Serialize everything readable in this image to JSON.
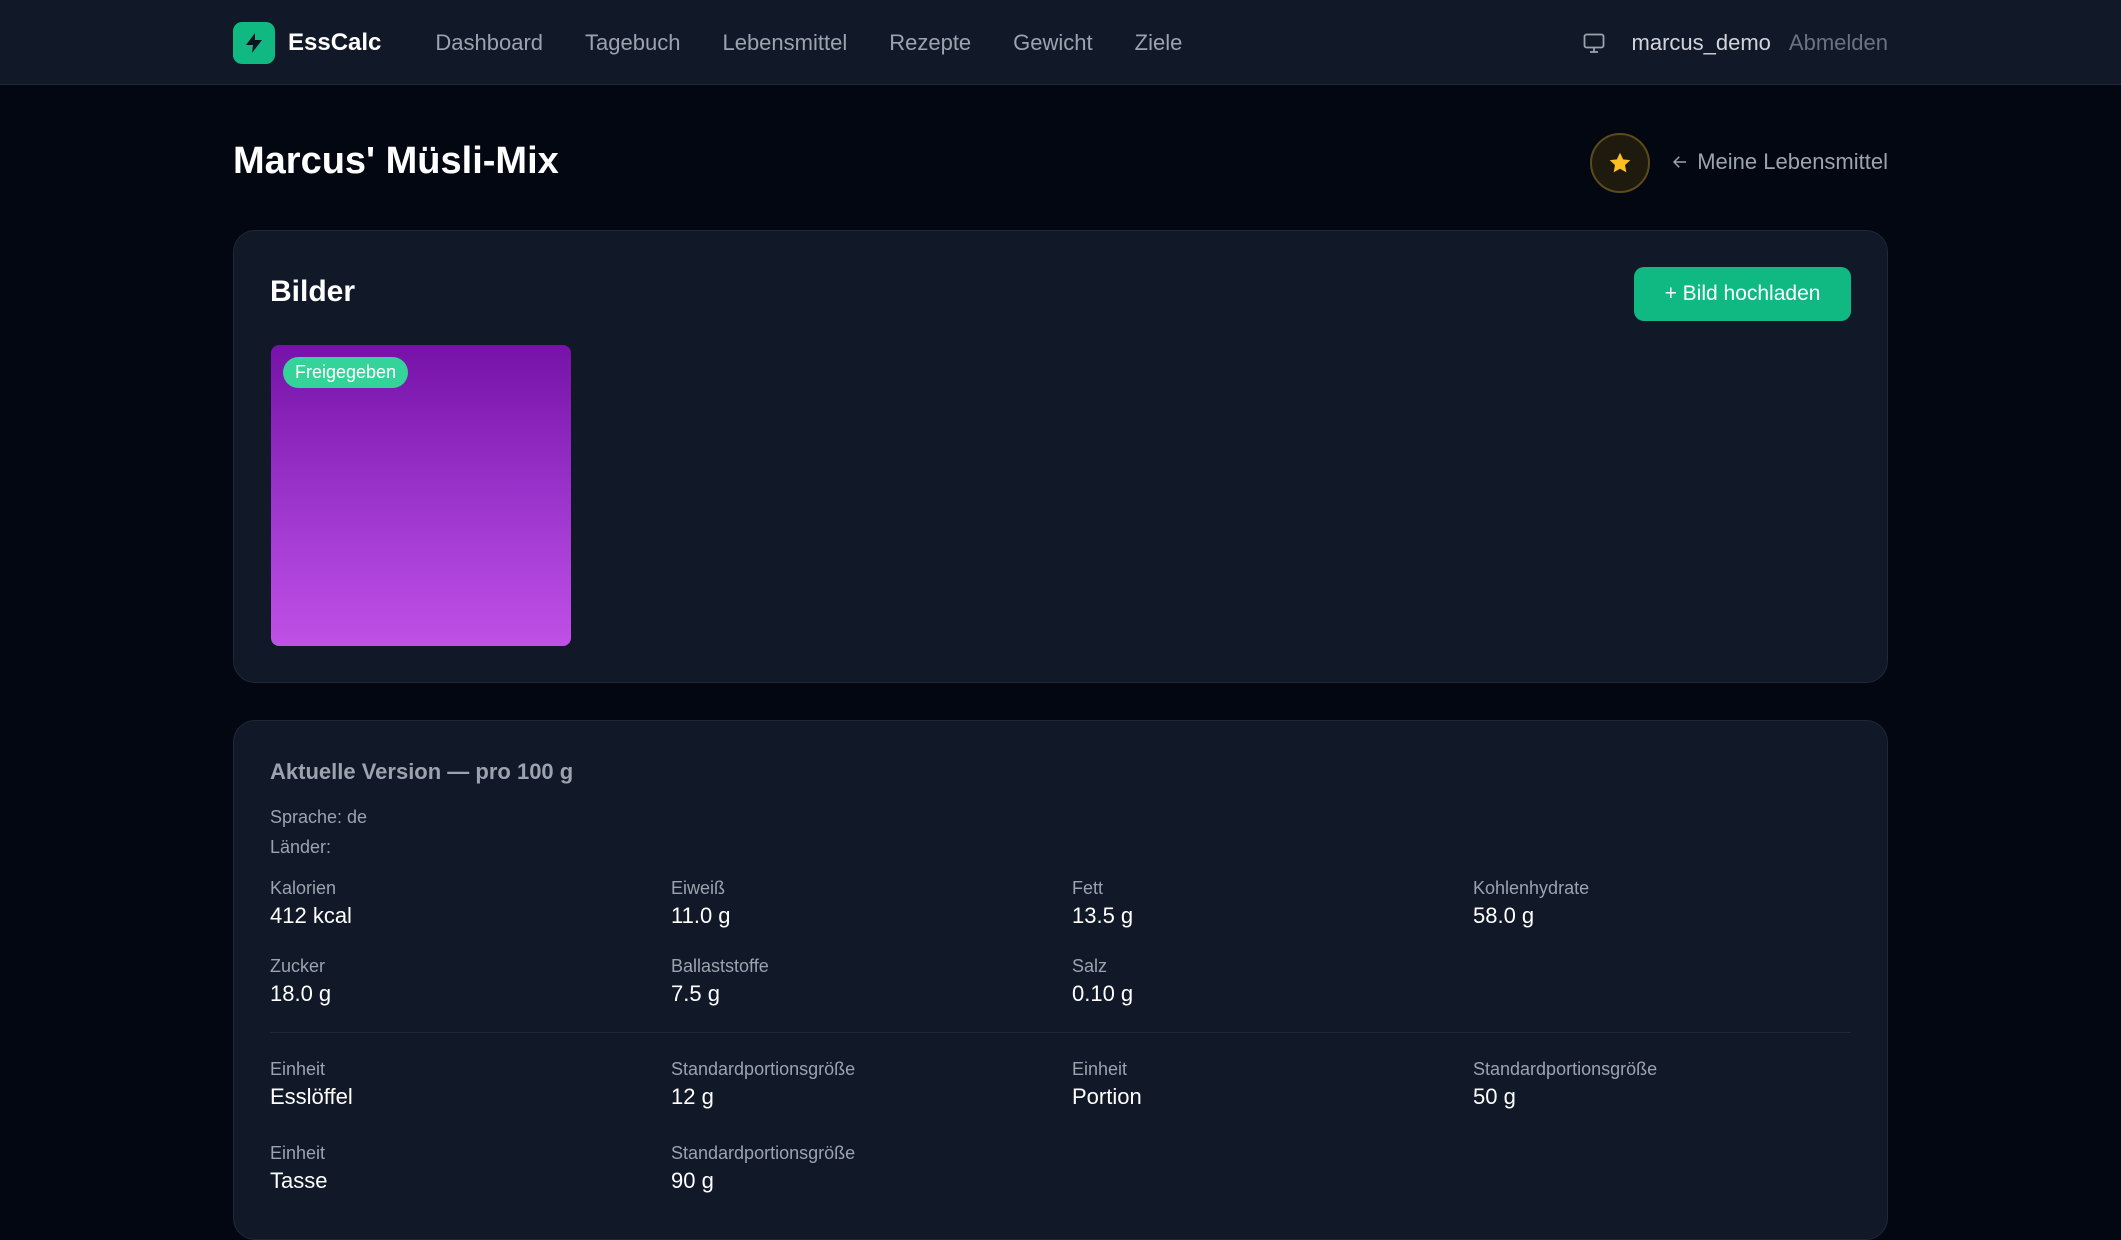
{
  "app": {
    "name": "EssCalc",
    "accent_color": "#10b981",
    "logo_icon": "lightning-bolt-icon"
  },
  "nav": {
    "items": [
      {
        "label": "Dashboard"
      },
      {
        "label": "Tagebuch"
      },
      {
        "label": "Lebensmittel"
      },
      {
        "label": "Rezepte"
      },
      {
        "label": "Gewicht"
      },
      {
        "label": "Ziele"
      }
    ],
    "username": "marcus_demo",
    "logout_label": "Abmelden",
    "monitor_icon": "monitor-icon"
  },
  "page": {
    "title": "Marcus' Müsli-Mix",
    "favorite_icon": "star-icon",
    "back_label": "Meine Lebensmittel"
  },
  "images_section": {
    "title": "Bilder",
    "upload_label": "+ Bild hochladen",
    "images": [
      {
        "badge": "Freigegeben"
      }
    ]
  },
  "version_section": {
    "title": "Aktuelle Version — pro 100 g",
    "language": "Sprache: de",
    "countries": "Länder:",
    "nutrients": [
      {
        "label": "Kalorien",
        "value": "412 kcal"
      },
      {
        "label": "Eiweiß",
        "value": "11.0 g"
      },
      {
        "label": "Fett",
        "value": "13.5 g"
      },
      {
        "label": "Kohlenhydrate",
        "value": "58.0 g"
      },
      {
        "label": "Zucker",
        "value": "18.0 g"
      },
      {
        "label": "Ballaststoffe",
        "value": "7.5 g"
      },
      {
        "label": "Salz",
        "value": "0.10 g"
      }
    ],
    "units": [
      {
        "unit_label": "Einheit",
        "unit": "Esslöffel",
        "size_label": "Standardportionsgröße",
        "size": "12 g"
      },
      {
        "unit_label": "Einheit",
        "unit": "Portion",
        "size_label": "Standardportionsgröße",
        "size": "50 g"
      },
      {
        "unit_label": "Einheit",
        "unit": "Tasse",
        "size_label": "Standardportionsgröße",
        "size": "90 g"
      }
    ]
  }
}
